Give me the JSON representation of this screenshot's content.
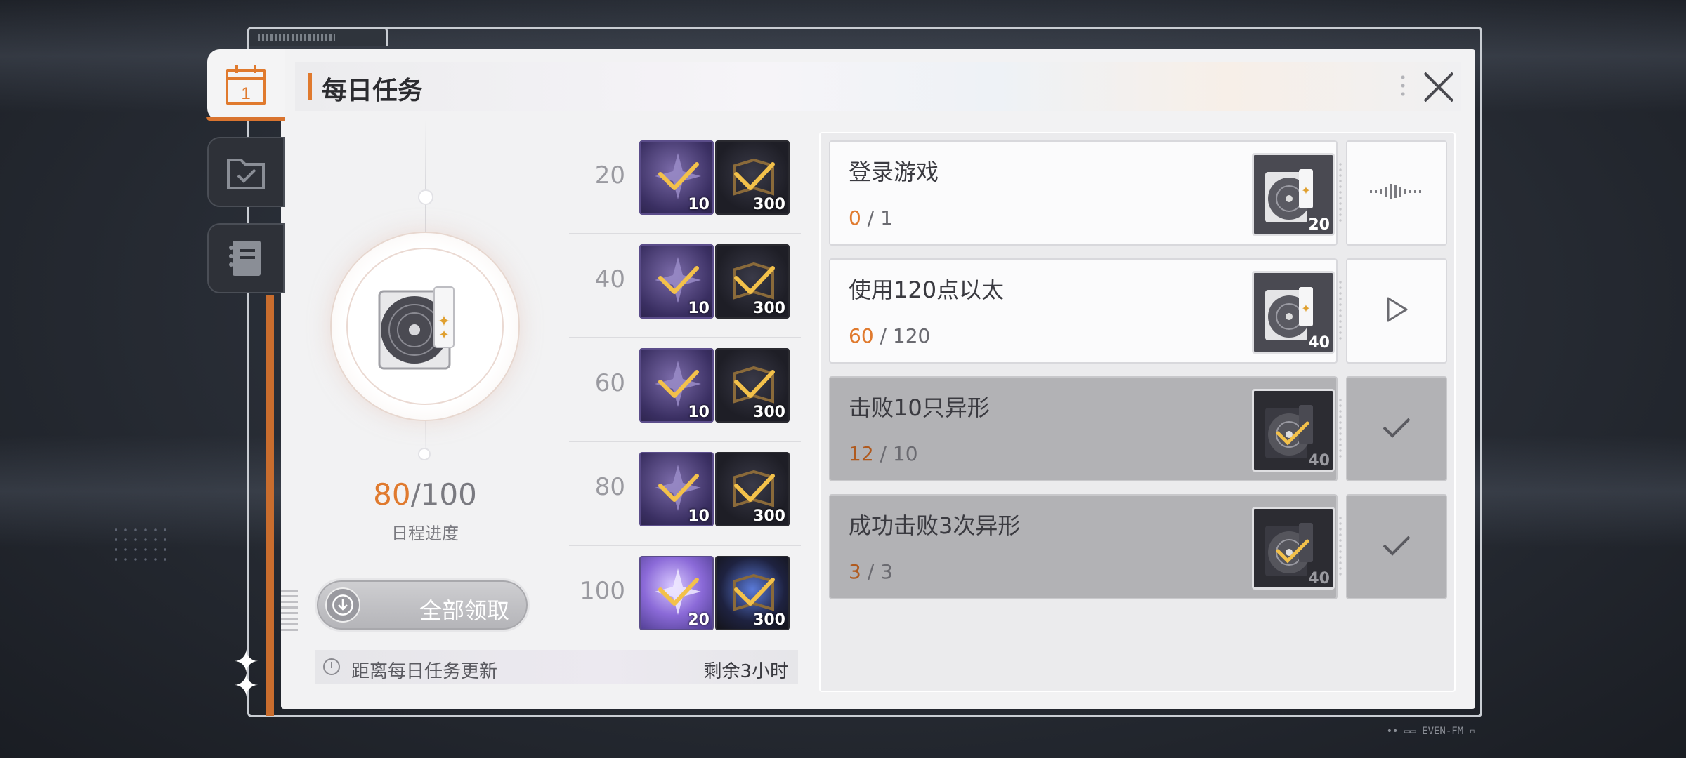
{
  "header": {
    "title": "每日任务",
    "calendar_day": "1"
  },
  "progress": {
    "current": "80",
    "total": "/100",
    "label": "日程进度"
  },
  "claim_all": {
    "label": "全部领取"
  },
  "refresh": {
    "text": "距离每日任务更新",
    "remaining": "剩余3小时"
  },
  "milestones": [
    {
      "points": "20",
      "rewards": [
        {
          "icon": "crystal",
          "count": "10"
        },
        {
          "icon": "book",
          "count": "300"
        }
      ]
    },
    {
      "points": "40",
      "rewards": [
        {
          "icon": "crystal",
          "count": "10"
        },
        {
          "icon": "book",
          "count": "300"
        }
      ]
    },
    {
      "points": "60",
      "rewards": [
        {
          "icon": "crystal",
          "count": "10"
        },
        {
          "icon": "book",
          "count": "300"
        }
      ]
    },
    {
      "points": "80",
      "rewards": [
        {
          "icon": "crystal",
          "count": "10"
        },
        {
          "icon": "book",
          "count": "300"
        }
      ]
    },
    {
      "points": "100",
      "rewards": [
        {
          "icon": "crystal",
          "count": "20"
        },
        {
          "icon": "book",
          "count": "300"
        }
      ]
    }
  ],
  "tasks": [
    {
      "name": "登录游戏",
      "current": "0",
      "total": " / 1",
      "reward_count": "20",
      "state": "in-progress",
      "action_icon": "waveform-icon"
    },
    {
      "name": "使用120点以太",
      "current": "60",
      "total": " / 120",
      "reward_count": "40",
      "state": "go",
      "action_icon": "play-icon"
    },
    {
      "name": "击败10只异形",
      "current": "12",
      "total": " / 10",
      "reward_count": "40",
      "state": "done",
      "action_icon": "check-icon"
    },
    {
      "name": "成功击败3次异形",
      "current": "3",
      "total": " / 3",
      "reward_count": "40",
      "state": "done",
      "action_icon": "check-icon"
    }
  ],
  "colors": {
    "accent": "#e07a2e",
    "panel": "#f2f2f3",
    "done": "#b2b2b5"
  },
  "watermark": "•• ▭▭ EVEN-FM ▫"
}
